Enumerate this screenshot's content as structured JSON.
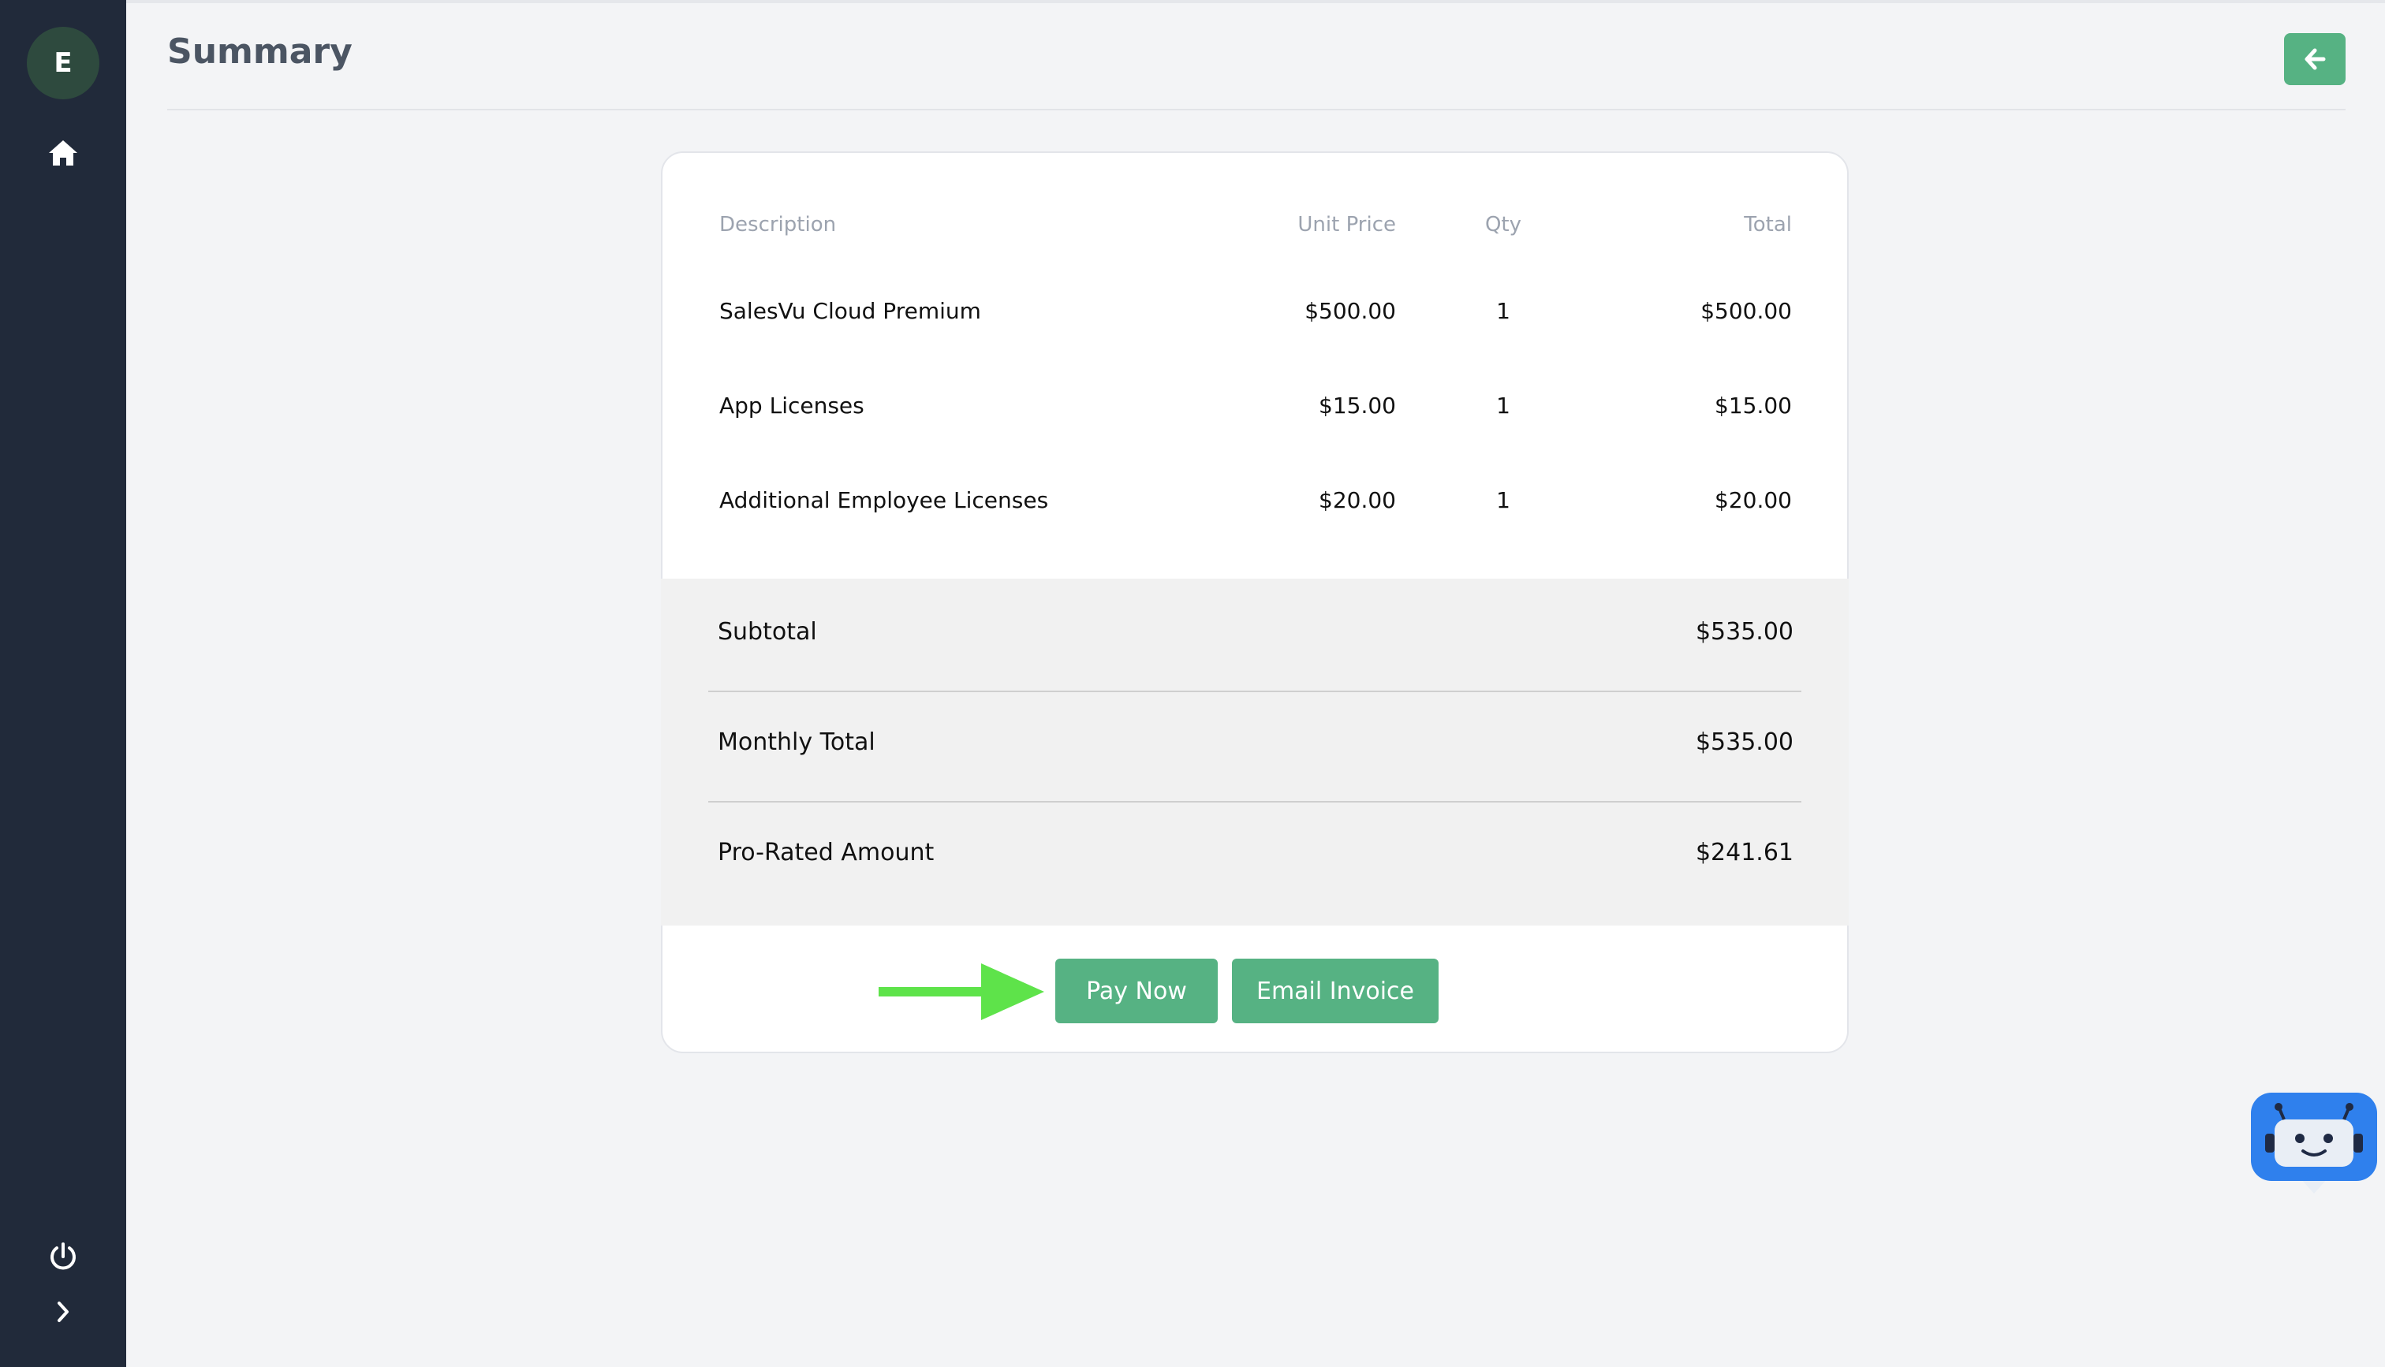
{
  "sidebar": {
    "avatar_initial": "E",
    "icons": [
      "home-icon",
      "power-icon",
      "chevron-right-icon"
    ]
  },
  "header": {
    "title": "Summary",
    "back_icon": "arrow-left-icon"
  },
  "invoice": {
    "columns": [
      "Description",
      "Unit Price",
      "Qty",
      "Total"
    ],
    "rows": [
      {
        "description": "SalesVu Cloud Premium",
        "unit_price": "$500.00",
        "qty": "1",
        "total": "$500.00"
      },
      {
        "description": "App Licenses",
        "unit_price": "$15.00",
        "qty": "1",
        "total": "$15.00"
      },
      {
        "description": "Additional Employee Licenses",
        "unit_price": "$20.00",
        "qty": "1",
        "total": "$20.00"
      }
    ],
    "summary": {
      "subtotal_label": "Subtotal",
      "subtotal_value": "$535.00",
      "monthly_label": "Monthly Total",
      "monthly_value": "$535.00",
      "prorated_label": "Pro-Rated Amount",
      "prorated_value": "$241.61"
    }
  },
  "actions": {
    "pay_now": "Pay Now",
    "email_invoice": "Email Invoice"
  },
  "colors": {
    "sidebar_bg": "#212a3a",
    "accent_green": "#56b283",
    "arrow_green": "#5ee34a",
    "chatbot_blue": "#2f80ed"
  }
}
